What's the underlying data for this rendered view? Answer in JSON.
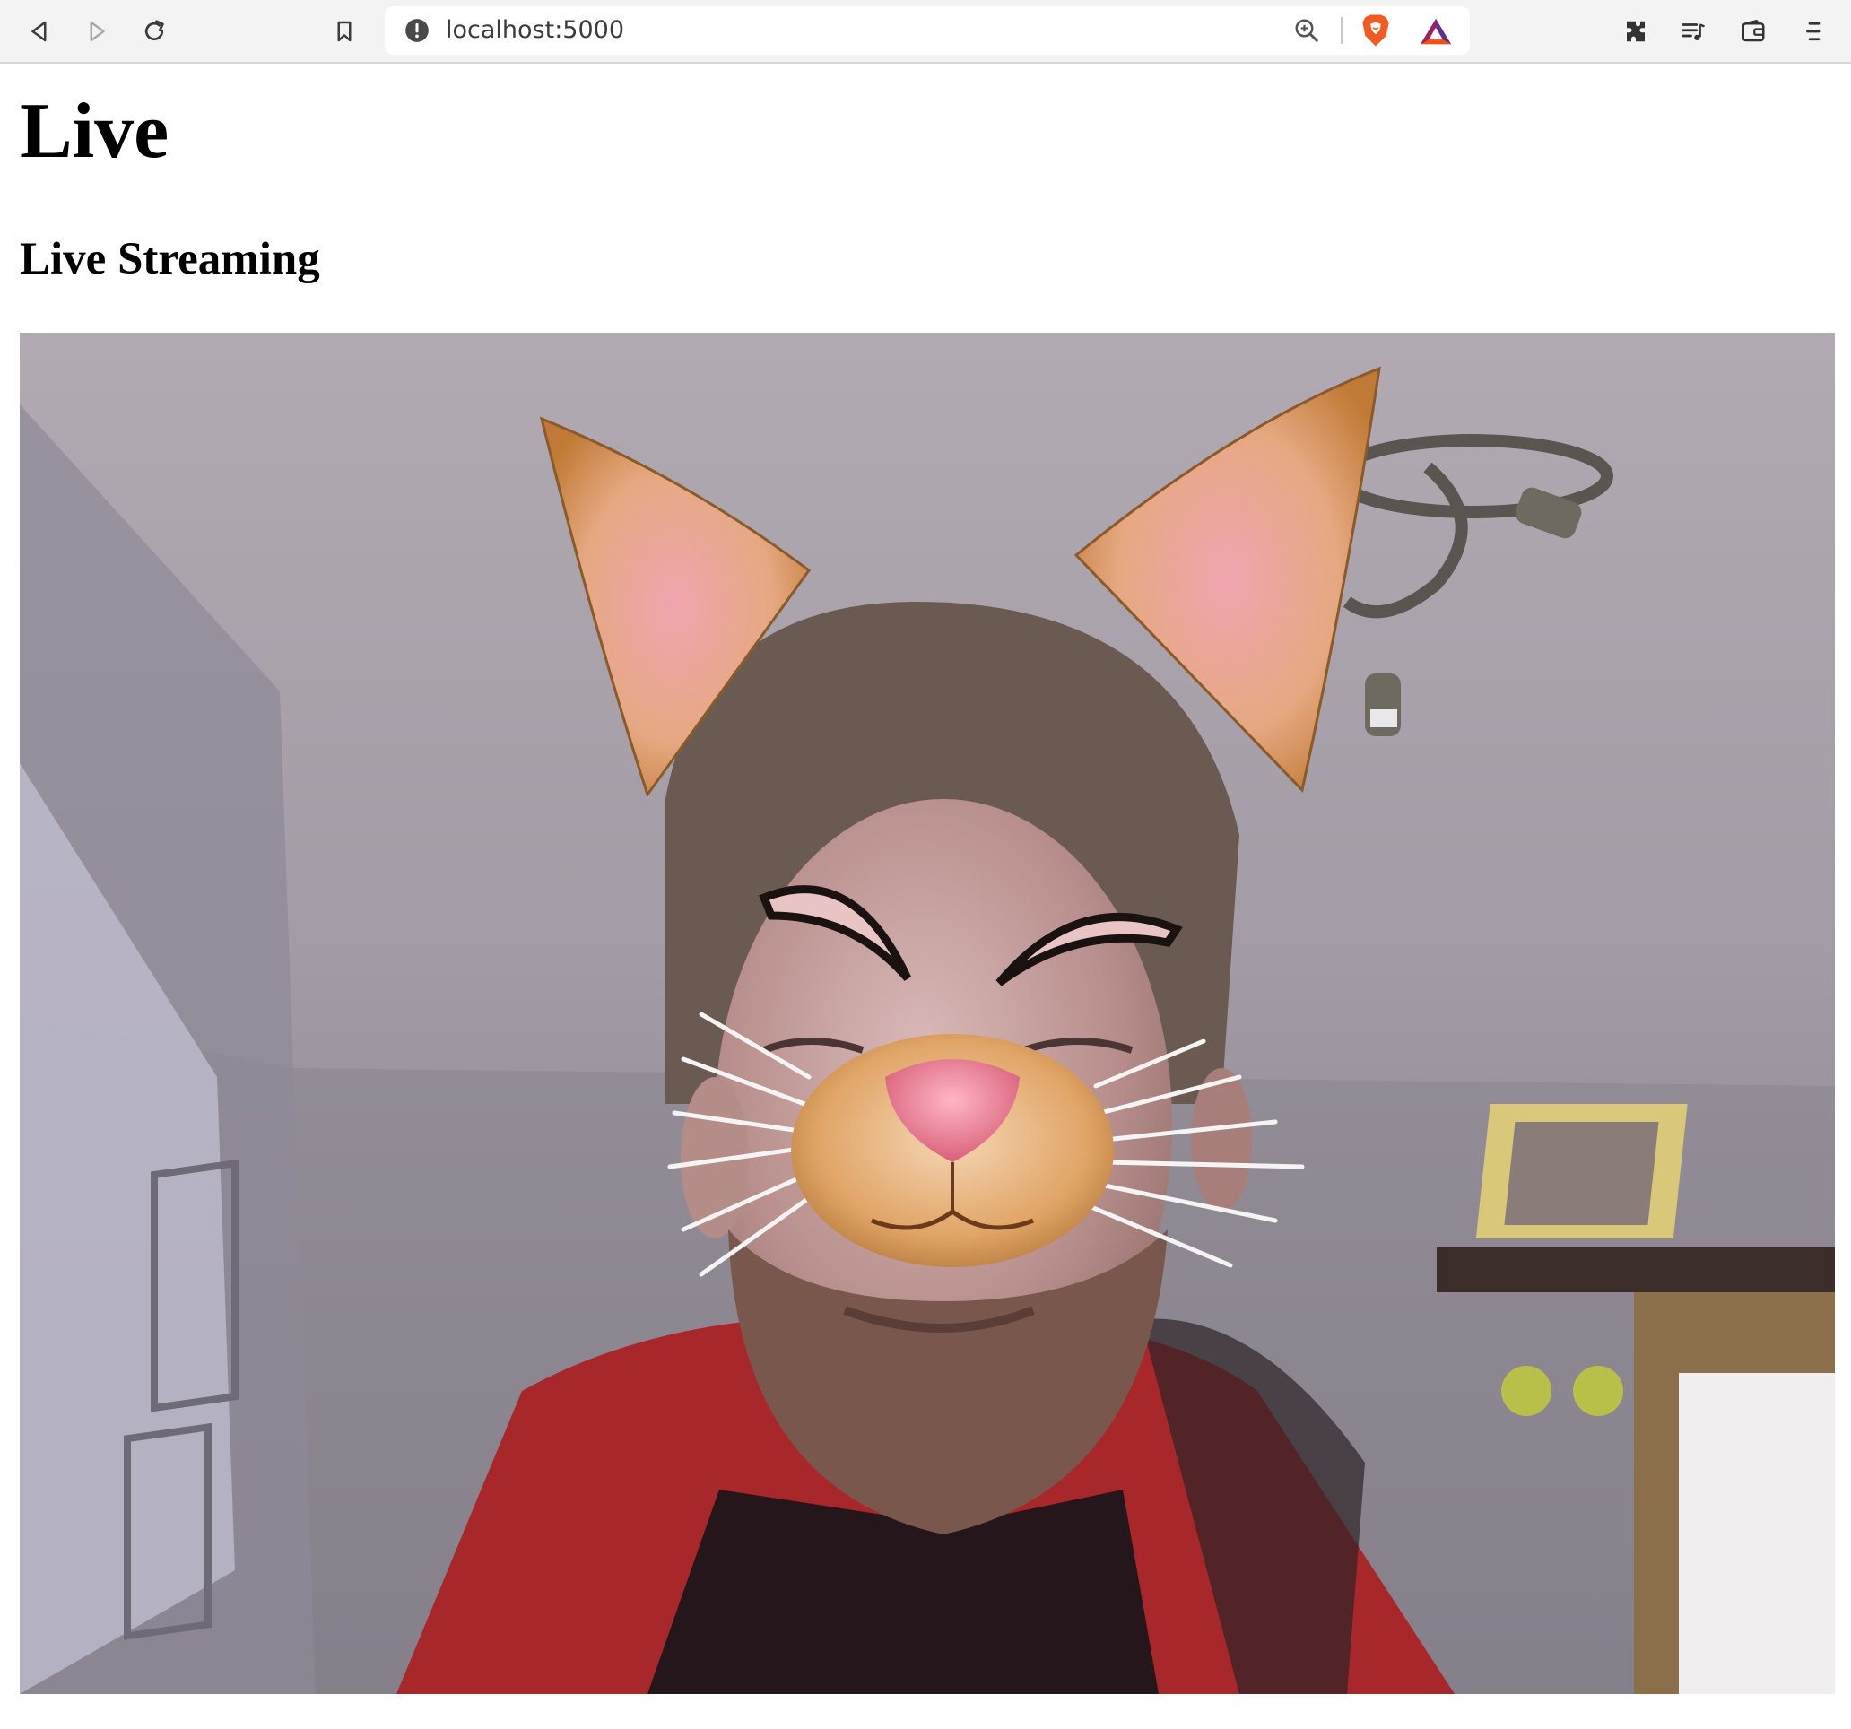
{
  "browser": {
    "url": "localhost:5000",
    "toolbar_icons": [
      "back-icon",
      "forward-icon",
      "reload-icon",
      "bookmark-icon",
      "site-info-icon",
      "zoom-icon",
      "brave-shields-icon",
      "brave-rewards-icon",
      "extensions-icon",
      "playlist-icon",
      "wallet-icon",
      "menu-icon"
    ]
  },
  "page": {
    "title": "Live",
    "subtitle": "Live Streaming"
  },
  "video": {
    "overlays": [
      "cat-ear-left",
      "cat-ear-right",
      "cat-eyebrow-left",
      "cat-eyebrow-right",
      "cat-nose",
      "cat-whiskers"
    ]
  }
}
